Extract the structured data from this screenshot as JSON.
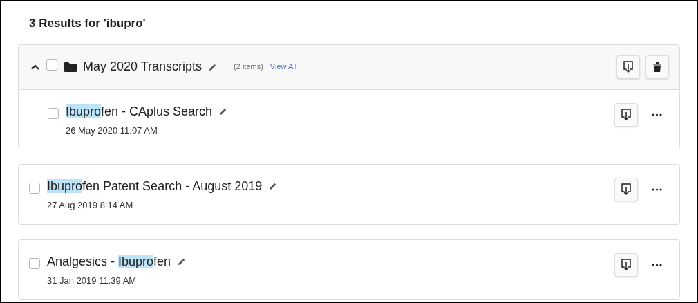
{
  "heading": "3 Results for 'ibupro'",
  "folder": {
    "name": "May 2020 Transcripts",
    "expanded": true,
    "checked": false,
    "count": "(2 items)",
    "link": "View All",
    "children": [
      {
        "checked": false,
        "title_parts": [
          {
            "text": "Ibupro",
            "highlighted": true
          },
          {
            "text": "fen - CAplus Search",
            "highlighted": false
          }
        ],
        "date": "26 May 2020 11:07 AM"
      }
    ]
  },
  "results": [
    {
      "checked": false,
      "title_parts": [
        {
          "text": "Ibupro",
          "highlighted": true
        },
        {
          "text": "fen Patent Search - August 2019",
          "highlighted": false
        }
      ],
      "date": "27 Aug 2019 8:14 AM"
    },
    {
      "checked": false,
      "title_parts": [
        {
          "text": "Analgesics - ",
          "highlighted": false
        },
        {
          "text": "Ibupro",
          "highlighted": true
        },
        {
          "text": "fen",
          "highlighted": false
        }
      ],
      "date": "31 Jan 2019 11:39 AM"
    }
  ]
}
